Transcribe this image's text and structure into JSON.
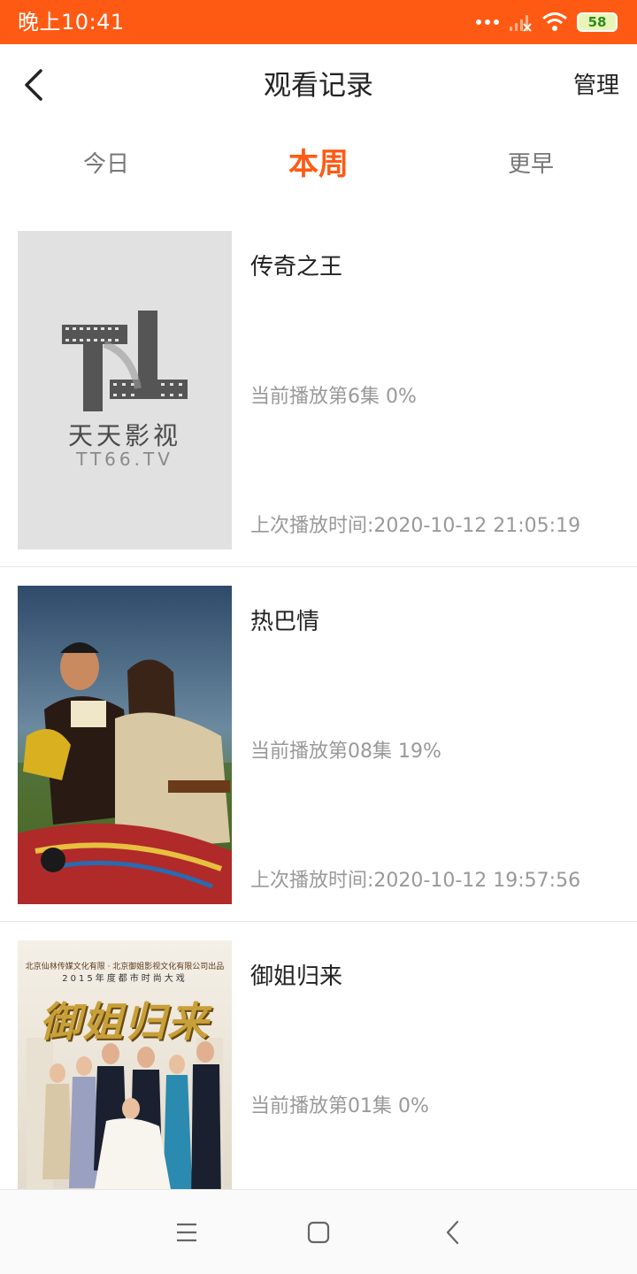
{
  "status_bar": {
    "time": "晚上10:41",
    "battery": "58",
    "icons": [
      "more-dots-icon",
      "signal-icon",
      "wifi-icon",
      "battery-icon"
    ]
  },
  "header": {
    "back_icon": "chevron-left-icon",
    "title": "观看记录",
    "manage_label": "管理"
  },
  "tabs": [
    {
      "label": "今日",
      "active": false
    },
    {
      "label": "本周",
      "active": true
    },
    {
      "label": "更早",
      "active": false
    }
  ],
  "history": [
    {
      "title": "传奇之王",
      "progress": "当前播放第6集 0%",
      "last_played": "上次播放时间:2020-10-12 21:05:19",
      "poster": {
        "type": "placeholder-logo",
        "brand": "天天影视",
        "url": "TT66.TV"
      }
    },
    {
      "title": "热巴情",
      "progress": "当前播放第08集 19%",
      "last_played": "上次播放时间:2020-10-12 19:57:56",
      "poster": {
        "type": "photo"
      }
    },
    {
      "title": "御姐归来",
      "progress": "当前播放第01集 0%",
      "last_played": "",
      "poster": {
        "type": "photo",
        "top_text": "北京仙林传媒文化有限 · 北京御姐影视文化有限公司出品",
        "sub_text": "2015年度都市时尚大戏",
        "title_art": "御姐归来"
      }
    }
  ],
  "nav_bar": {
    "icons": [
      "menu-icon",
      "home-square-icon",
      "back-triangle-icon"
    ]
  },
  "colors": {
    "accent": "#ff5a14",
    "text_primary": "#222222",
    "text_secondary": "#999999",
    "divider": "#e6e6e6"
  }
}
